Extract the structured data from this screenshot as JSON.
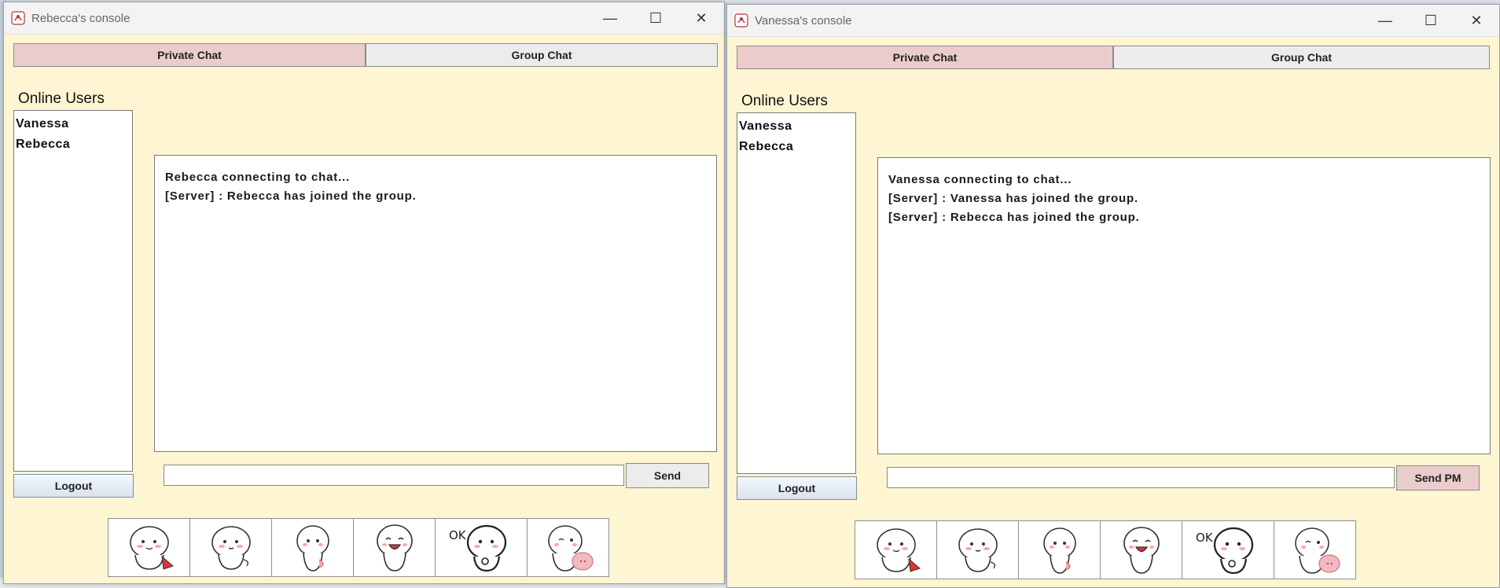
{
  "windows": [
    {
      "title": "Rebecca's console",
      "tabs": {
        "private": "Private Chat",
        "group": "Group Chat"
      },
      "online_label": "Online Users",
      "users": [
        "Vanessa",
        "Rebecca"
      ],
      "chat_lines": [
        "Rebecca connecting to chat...",
        "[Server] : Rebecca has joined the group."
      ],
      "input_value": "",
      "send_label": "Send",
      "logout_label": "Logout",
      "stickers": [
        "sticker-wave",
        "sticker-shy",
        "sticker-peek",
        "sticker-laugh",
        "sticker-ok",
        "sticker-pig"
      ]
    },
    {
      "title": "Vanessa's console",
      "tabs": {
        "private": "Private Chat",
        "group": "Group Chat"
      },
      "online_label": "Online Users",
      "users": [
        "Vanessa",
        "Rebecca"
      ],
      "chat_lines": [
        "Vanessa connecting to chat...",
        "[Server] : Vanessa has joined the group.",
        "[Server] : Rebecca has joined the group."
      ],
      "input_value": "",
      "send_label": "Send PM",
      "logout_label": "Logout",
      "stickers": [
        "sticker-wave",
        "sticker-shy",
        "sticker-peek",
        "sticker-laugh",
        "sticker-ok",
        "sticker-pig"
      ]
    }
  ],
  "sticker_ok_text": "OK",
  "window_controls": {
    "minimize": "—",
    "maximize": "☐",
    "close": "✕"
  },
  "colors": {
    "window_bg": "#fef5d2",
    "active_tab": "#ebcccc",
    "inactive_tab": "#ececec",
    "send_pm": "#ebcccc"
  }
}
